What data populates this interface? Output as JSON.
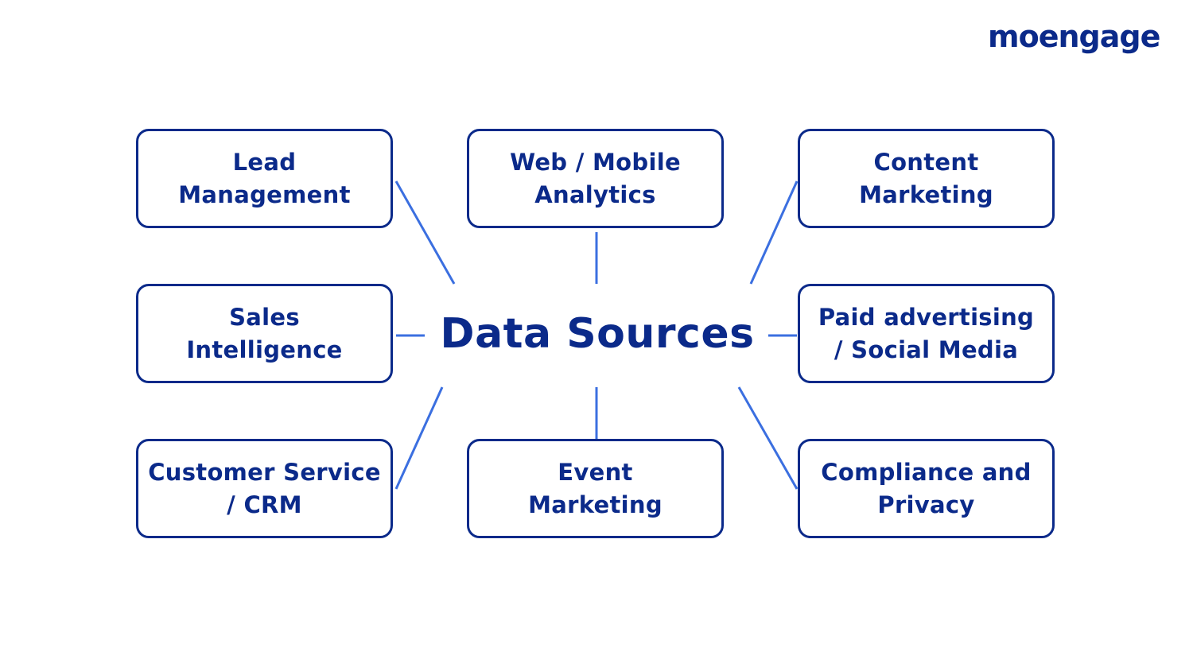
{
  "brand": {
    "logo_text": "moengage"
  },
  "diagram": {
    "center_label": "Data Sources",
    "nodes": [
      {
        "id": "lead-management",
        "label": "Lead\nManagement",
        "position": "top-left"
      },
      {
        "id": "web-mobile-analytics",
        "label": "Web / Mobile\nAnalytics",
        "position": "top-center"
      },
      {
        "id": "content-marketing",
        "label": "Content\nMarketing",
        "position": "top-right"
      },
      {
        "id": "sales-intelligence",
        "label": "Sales\nIntelligence",
        "position": "middle-left"
      },
      {
        "id": "paid-advertising-social-media",
        "label": "Paid advertising\n/ Social Media",
        "position": "middle-right"
      },
      {
        "id": "customer-service-crm",
        "label": "Customer Service\n/ CRM",
        "position": "bottom-left"
      },
      {
        "id": "event-marketing",
        "label": "Event\nMarketing",
        "position": "bottom-center"
      },
      {
        "id": "compliance-and-privacy",
        "label": "Compliance and\nPrivacy",
        "position": "bottom-right"
      }
    ],
    "colors": {
      "border": "#0b2a8a",
      "text": "#0b2a8a",
      "connector": "#3b6fe0"
    }
  }
}
